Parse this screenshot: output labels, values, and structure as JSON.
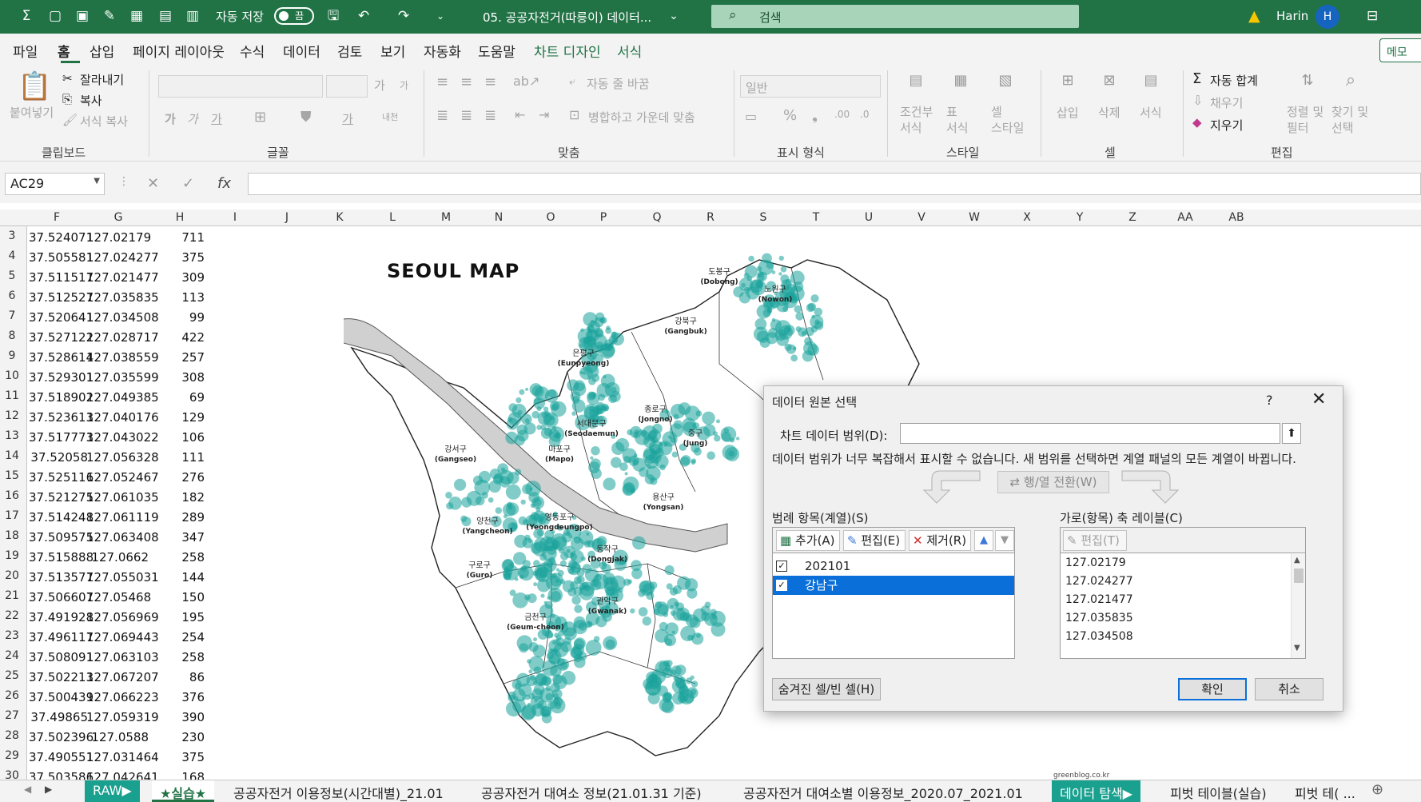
{
  "titlebar": {
    "autosave_label": "자동 저장",
    "autosave_state": "끔",
    "doc_title": "05. 공공자전거(따릉이) 데이터...",
    "search_placeholder": "검색",
    "user_name": "Harin",
    "avatar_initial": "H",
    "bg_color": "#217346"
  },
  "menu": {
    "tabs": [
      "파일",
      "홈",
      "삽입",
      "페이지 레이아웃",
      "수식",
      "데이터",
      "검토",
      "보기",
      "자동화",
      "도움말",
      "차트 디자인",
      "서식"
    ],
    "active_tab": "홈",
    "share_label": "메모"
  },
  "ribbon": {
    "clipboard": {
      "paste": "붙여넣기",
      "cut": "잘라내기",
      "copy": "복사",
      "format_painter": "서식 복사",
      "group": "클립보드"
    },
    "font": {
      "group": "글꼴",
      "grow": "가",
      "shrink": "가",
      "bold": "가",
      "italic": "가",
      "underline": "가",
      "font_color": "가",
      "special": "내천"
    },
    "align": {
      "wrap": "자동 줄 바꿈",
      "merge": "병합하고 가운데 맞춤",
      "group": "맞춤"
    },
    "number": {
      "format": "일반",
      "group": "표시 형식"
    },
    "styles": {
      "conditional": "조건부\n서식",
      "table": "표\n서식",
      "cell_style": "셀\n스타일",
      "group": "스타일"
    },
    "cells": {
      "insert": "삽입",
      "delete": "삭제",
      "format": "서식",
      "group": "셀"
    },
    "editing": {
      "autosum": "자동 합계",
      "fill": "채우기",
      "clear": "지우기",
      "sort": "정렬 및\n필터",
      "find": "찾기 및\n선택",
      "group": "편집"
    }
  },
  "formula_bar": {
    "name_box": "AC29",
    "fx": "fx",
    "value": ""
  },
  "grid": {
    "columns": [
      "F",
      "G",
      "H",
      "I",
      "J",
      "K",
      "L",
      "M",
      "N",
      "O",
      "P",
      "Q",
      "R",
      "S",
      "T",
      "U",
      "V",
      "W",
      "X",
      "Y",
      "Z",
      "AA",
      "AB"
    ],
    "rows": [
      {
        "n": "3",
        "f": "37.524071",
        "g": "127.02179",
        "h": "711"
      },
      {
        "n": "4",
        "f": "37.505581",
        "g": "127.024277",
        "h": "375"
      },
      {
        "n": "5",
        "f": "37.511517",
        "g": "127.021477",
        "h": "309"
      },
      {
        "n": "6",
        "f": "37.512527",
        "g": "127.035835",
        "h": "113"
      },
      {
        "n": "7",
        "f": "37.520641",
        "g": "127.034508",
        "h": "99"
      },
      {
        "n": "8",
        "f": "37.527122",
        "g": "127.028717",
        "h": "422"
      },
      {
        "n": "9",
        "f": "37.528614",
        "g": "127.038559",
        "h": "257"
      },
      {
        "n": "10",
        "f": "37.529301",
        "g": "127.035599",
        "h": "308"
      },
      {
        "n": "11",
        "f": "37.518902",
        "g": "127.049385",
        "h": "69"
      },
      {
        "n": "12",
        "f": "37.523613",
        "g": "127.040176",
        "h": "129"
      },
      {
        "n": "13",
        "f": "37.517773",
        "g": "127.043022",
        "h": "106"
      },
      {
        "n": "14",
        "f": "37.52058",
        "g": "127.056328",
        "h": "111"
      },
      {
        "n": "15",
        "f": "37.525116",
        "g": "127.052467",
        "h": "276"
      },
      {
        "n": "16",
        "f": "37.521275",
        "g": "127.061035",
        "h": "182"
      },
      {
        "n": "17",
        "f": "37.514248",
        "g": "127.061119",
        "h": "289"
      },
      {
        "n": "18",
        "f": "37.509575",
        "g": "127.063408",
        "h": "347"
      },
      {
        "n": "19",
        "f": "37.515888",
        "g": "127.0662",
        "h": "258"
      },
      {
        "n": "20",
        "f": "37.513577",
        "g": "127.055031",
        "h": "144"
      },
      {
        "n": "21",
        "f": "37.506607",
        "g": "127.05468",
        "h": "150"
      },
      {
        "n": "22",
        "f": "37.491928",
        "g": "127.056969",
        "h": "195"
      },
      {
        "n": "23",
        "f": "37.496117",
        "g": "127.069443",
        "h": "254"
      },
      {
        "n": "24",
        "f": "37.508091",
        "g": "127.063103",
        "h": "258"
      },
      {
        "n": "25",
        "f": "37.502213",
        "g": "127.067207",
        "h": "86"
      },
      {
        "n": "26",
        "f": "37.500439",
        "g": "127.066223",
        "h": "376"
      },
      {
        "n": "27",
        "f": "37.49865",
        "g": "127.059319",
        "h": "390"
      },
      {
        "n": "28",
        "f": "37.502396",
        "g": "127.0588",
        "h": "230"
      },
      {
        "n": "29",
        "f": "37.490551",
        "g": "127.031464",
        "h": "375"
      },
      {
        "n": "30",
        "f": "37.503586",
        "g": "127.042641",
        "h": "168"
      }
    ]
  },
  "map": {
    "title": "SEOUL MAP",
    "credit": "greenblog.co.kr",
    "bubble_color": "#1aa39a",
    "districts": [
      {
        "ko": "도봉구",
        "en": "(Dobong)"
      },
      {
        "ko": "노원구",
        "en": "(Nowon)"
      },
      {
        "ko": "강북구",
        "en": "(Gangbuk)"
      },
      {
        "ko": "은평구",
        "en": "(Eunpyeong)"
      },
      {
        "ko": "종로구",
        "en": "(Jongno)"
      },
      {
        "ko": "서대문구",
        "en": "(Seodaemun)"
      },
      {
        "ko": "마포구",
        "en": "(Mapo)"
      },
      {
        "ko": "중구",
        "en": "(Jung)"
      },
      {
        "ko": "용산구",
        "en": "(Yongsan)"
      },
      {
        "ko": "양천구",
        "en": "(Yangcheon)"
      },
      {
        "ko": "영등포구",
        "en": "(Yeongdeungpo)"
      },
      {
        "ko": "동작구",
        "en": "(Dongjak)"
      },
      {
        "ko": "구로구",
        "en": "(Guro)"
      },
      {
        "ko": "관악구",
        "en": "(Gwanak)"
      },
      {
        "ko": "금천구",
        "en": "(Geum-cheon)"
      },
      {
        "ko": "강서구",
        "en": "(Gangseo)"
      }
    ]
  },
  "dialog": {
    "title": "데이터 원본 선택",
    "help": "?",
    "close": "✕",
    "range_label": "차트 데이터 범위(D):",
    "range_value": "",
    "message": "데이터 범위가 너무 복잡해서 표시할 수 없습니다. 새 범위를 선택하면 계열 패널의 모든 계열이 바뀝니다.",
    "switch_label": "행/열 전환(W)",
    "legend_label": "범례 항목(계열)(S)",
    "axis_label": "가로(항목) 축 레이블(C)",
    "add_label": "추가(A)",
    "edit_label": "편집(E)",
    "remove_label": "제거(R)",
    "axis_edit_label": "편집(T)",
    "series": [
      {
        "name": "202101",
        "checked": true,
        "selected": false
      },
      {
        "name": "강남구",
        "checked": true,
        "selected": true
      }
    ],
    "axis_values": [
      "127.02179",
      "127.024277",
      "127.021477",
      "127.035835",
      "127.034508"
    ],
    "hidden_label": "숨겨진 셀/빈 셀(H)",
    "ok_label": "확인",
    "cancel_label": "취소"
  },
  "sheets": {
    "tabs": [
      {
        "label": "RAW▶",
        "style": "green"
      },
      {
        "label": "★실습★",
        "style": "active"
      },
      {
        "label": "공공자전거 이용정보(시간대별)_21.01",
        "style": "normal"
      },
      {
        "label": "공공자전거 대여소 정보(21.01.31 기준)",
        "style": "normal"
      },
      {
        "label": "공공자전거 대여소별 이용정보_2020.07_2021.01",
        "style": "normal"
      },
      {
        "label": "데이터 탐색▶",
        "style": "green"
      },
      {
        "label": "피벗 테이블(실습)",
        "style": "normal"
      },
      {
        "label": "피벗 테( ...",
        "style": "normal"
      }
    ]
  }
}
